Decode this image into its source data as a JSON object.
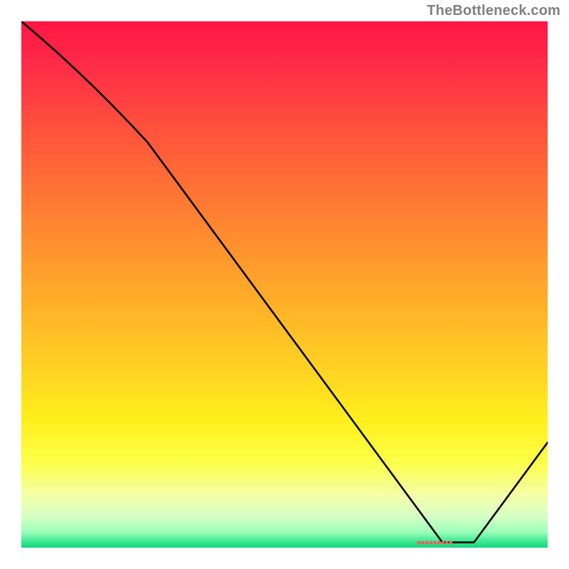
{
  "attribution": "TheBottleneck.com",
  "marker_text": "●●●●●●●●●",
  "chart_data": {
    "type": "line",
    "title": "",
    "xlabel": "",
    "ylabel": "",
    "xlim": [
      0,
      100
    ],
    "ylim": [
      0,
      100
    ],
    "grid": false,
    "legend": false,
    "background": "vertical-gradient red→orange→yellow→green",
    "series": [
      {
        "name": "curve",
        "x": [
          0,
          24,
          80,
          86,
          100
        ],
        "y": [
          100,
          77,
          1,
          1,
          20
        ]
      }
    ],
    "analytic_form": "piecewise-linear: (0,100)→(24,77)→(80,1)→(86,1)→(100,20)",
    "marker_region": {
      "x_start": 70,
      "x_end": 87,
      "y": 1
    }
  }
}
